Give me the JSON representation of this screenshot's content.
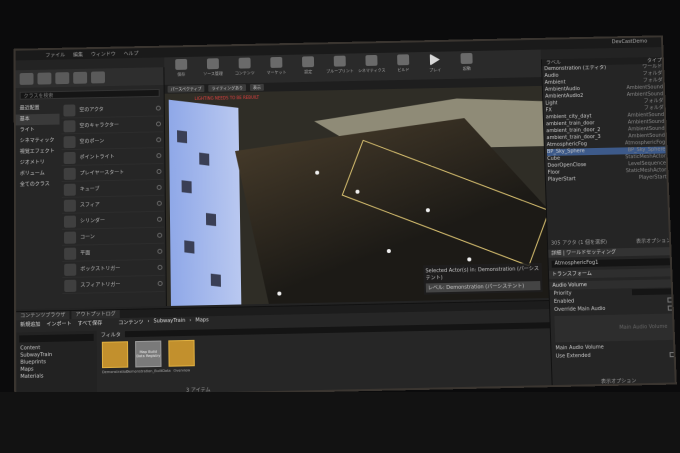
{
  "app": {
    "window_title": "DevCastDemo"
  },
  "menu": [
    "ファイル",
    "編集",
    "ウィンドウ",
    "ヘルプ"
  ],
  "toolbar": [
    {
      "label": "保存",
      "icon": "save-icon"
    },
    {
      "label": "ソース管理",
      "icon": "source-control-icon"
    },
    {
      "label": "コンテンツ",
      "icon": "content-icon"
    },
    {
      "label": "マーケット",
      "icon": "market-icon"
    },
    {
      "label": "設定",
      "icon": "settings-icon"
    },
    {
      "label": "ブループリント",
      "icon": "blueprint-icon"
    },
    {
      "label": "シネマティクス",
      "icon": "cinematics-icon"
    },
    {
      "label": "ビルド",
      "icon": "build-icon"
    },
    {
      "label": "プレイ",
      "icon": "play-icon"
    },
    {
      "label": "起動",
      "icon": "launch-icon"
    }
  ],
  "modes": {
    "search_placeholder": "クラスを検索",
    "categories": [
      "最近配置",
      "基本",
      "ライト",
      "シネマティック",
      "視覚エフェクト",
      "ジオメトリ",
      "ボリューム",
      "全てのクラス"
    ],
    "items": [
      "空のアクタ",
      "空のキャラクター",
      "空のポーン",
      "ポイントライト",
      "プレイヤースタート",
      "キューブ",
      "スフィア",
      "シリンダー",
      "コーン",
      "平面",
      "ボックストリガー",
      "スフィアトリガー"
    ]
  },
  "viewport": {
    "buttons": [
      "パースペクティブ",
      "ライティングあり",
      "表示"
    ],
    "warning": "LIGHTING NEEDS TO BE REBUILT",
    "selected_info": "Selected Actor(s) in: Demonstration (パーシステント)",
    "level_info": "レベル: Demonstration (パーシステント)"
  },
  "outliner": {
    "columns": [
      "ラベル",
      "タイプ"
    ],
    "rows": [
      {
        "name": "Demonstration (エディタ)",
        "type": "ワールド"
      },
      {
        "name": "Audio",
        "type": "フォルダ"
      },
      {
        "name": "Ambient",
        "type": "フォルダ"
      },
      {
        "name": "AmbientAudio",
        "type": "AmbientSound"
      },
      {
        "name": "AmbientAudio2",
        "type": "AmbientSound"
      },
      {
        "name": "Light",
        "type": "フォルダ"
      },
      {
        "name": "FX",
        "type": "フォルダ"
      },
      {
        "name": "ambient_city_dayt",
        "type": "AmbientSound"
      },
      {
        "name": "ambient_train_door",
        "type": "AmbientSound"
      },
      {
        "name": "ambient_train_door_2",
        "type": "AmbientSound"
      },
      {
        "name": "ambient_train_door_3",
        "type": "AmbientSound"
      },
      {
        "name": "AtmosphericFog",
        "type": "AtmosphericFog"
      },
      {
        "name": "BP_Sky_Sphere",
        "type": "BP_Sky_Sphere"
      },
      {
        "name": "Cube",
        "type": "StaticMeshActor"
      },
      {
        "name": "DoorOpenClose",
        "type": "LevelSequence"
      },
      {
        "name": "Floor",
        "type": "StaticMeshActor"
      },
      {
        "name": "PlayerStart",
        "type": "PlayerStart"
      }
    ],
    "selected_index": 12,
    "actor_count": "305 アクタ (1 個を選択)",
    "view_options": "表示オプション"
  },
  "details": {
    "tabs": [
      "詳細",
      "ワールドセッティング"
    ],
    "name_value": "AtmosphericFog1",
    "sections": [
      "トランスフォーム",
      "Audio Volume"
    ],
    "props": [
      "Priority",
      "Enabled",
      "Override Main Audio"
    ],
    "preview_label": "Main Audio Volume",
    "more": "Main Audio Volume",
    "child": "Use Extended"
  },
  "content_browser": {
    "tabs": [
      "コンテンツブラウザ",
      "アウトプットログ"
    ],
    "buttons": [
      "新規追加",
      "インポート",
      "すべて保存"
    ],
    "path": [
      "コンテンツ",
      "SubwayTrain",
      "Maps"
    ],
    "sources": [
      "Content",
      "SubwayTrain",
      "Blueprints",
      "Maps",
      "Materials"
    ],
    "filter_label": "フィルタ",
    "assets": [
      {
        "name": "Demonstration",
        "kind": "map"
      },
      {
        "name": "Demonstration_BuiltData",
        "kind": "registry",
        "thumb_text": "Map Build Data Registry"
      },
      {
        "name": "Overview",
        "kind": "map"
      }
    ],
    "item_count": "3 アイテム",
    "view_options": "表示オプション"
  }
}
